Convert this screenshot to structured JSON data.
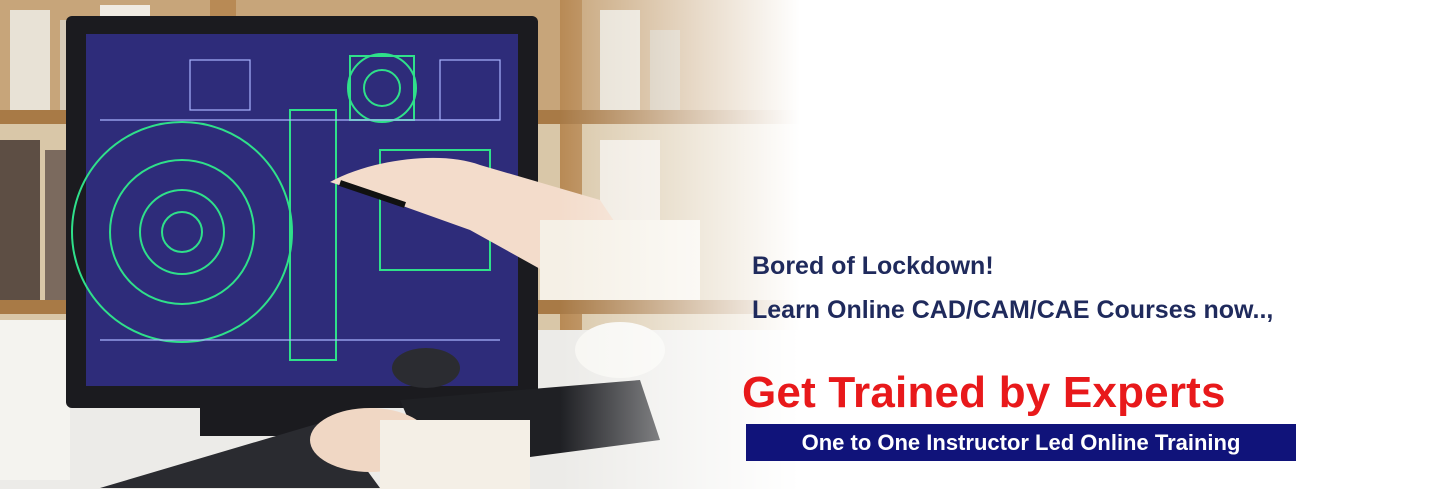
{
  "banner": {
    "line1": "Bored of Lockdown!",
    "line2": "Learn Online CAD/CAM/CAE Courses now..,",
    "headline": "Get Trained by Experts",
    "tagline": "One to One Instructor Led Online Training"
  },
  "colors": {
    "line_text": "#1f2a5c",
    "headline": "#e8191b",
    "tag_bg": "#10137a",
    "tag_text": "#ffffff",
    "screen": "#2e2c7a",
    "cad_green": "#2fe08a"
  }
}
